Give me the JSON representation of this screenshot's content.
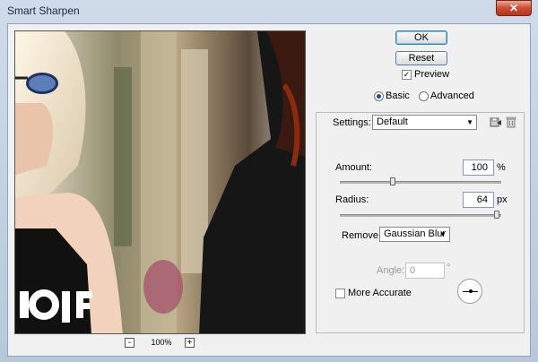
{
  "window": {
    "title": "Smart Sharpen",
    "close_glyph": "✕"
  },
  "preview": {
    "zoom_label": "100%",
    "zoom_out": "-",
    "zoom_in": "+"
  },
  "buttons": {
    "ok": "OK",
    "reset": "Reset"
  },
  "preview_toggle": {
    "label": "Preview",
    "checked": true
  },
  "mode": {
    "basic": "Basic",
    "advanced": "Advanced",
    "selected": "basic"
  },
  "settings": {
    "label": "Settings:",
    "value": "Default"
  },
  "amount": {
    "label": "Amount:",
    "value": "100",
    "unit": "%",
    "slider_fraction": 0.33
  },
  "radius": {
    "label": "Radius:",
    "value": "64",
    "unit": "px",
    "slider_fraction": 0.97
  },
  "remove": {
    "label": "Remove:",
    "value": "Gaussian Blur"
  },
  "angle": {
    "label": "Angle:",
    "value": "0",
    "unit": "°",
    "enabled": false
  },
  "more_accurate": {
    "label": "More Accurate",
    "checked": false
  },
  "icons": {
    "save": "save-settings-icon",
    "delete": "trash-icon"
  }
}
